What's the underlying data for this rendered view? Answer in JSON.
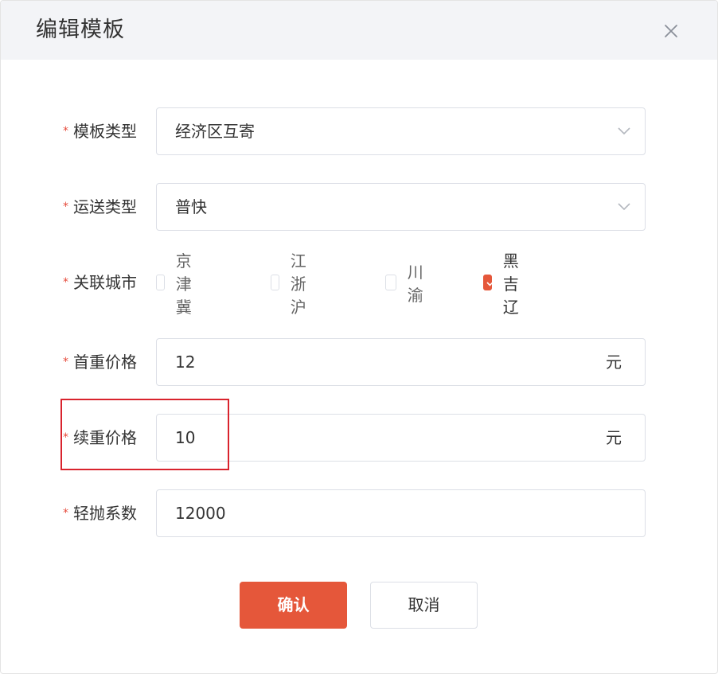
{
  "dialog": {
    "title": "编辑模板",
    "close_icon": "close-icon"
  },
  "form": {
    "template_type": {
      "label": "模板类型",
      "value": "经济区互寄",
      "required": true
    },
    "shipping_type": {
      "label": "运送类型",
      "value": "普快",
      "required": true
    },
    "cities": {
      "label": "关联城市",
      "required": true,
      "options": [
        {
          "label": "京津冀",
          "checked": false
        },
        {
          "label": "江浙沪",
          "checked": false
        },
        {
          "label": "川渝",
          "checked": false
        },
        {
          "label": "黑吉辽",
          "checked": true
        }
      ]
    },
    "first_weight_price": {
      "label": "首重价格",
      "value": "12",
      "suffix": "元",
      "required": true
    },
    "additional_weight_price": {
      "label": "续重价格",
      "value": "10",
      "suffix": "元",
      "required": true
    },
    "volumetric_factor": {
      "label": "轻抛系数",
      "value": "12000",
      "required": true
    }
  },
  "buttons": {
    "confirm": "确认",
    "cancel": "取消"
  },
  "required_mark": "*",
  "colors": {
    "accent": "#e5573a",
    "required": "#e64b3c",
    "highlight_border": "#d9232d",
    "header_bg": "#f3f4f7"
  }
}
